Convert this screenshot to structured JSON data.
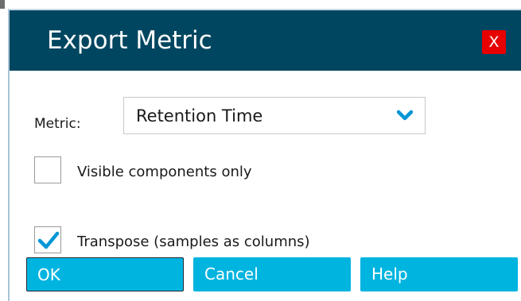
{
  "dialog": {
    "title": "Export Metric",
    "close_label": "X"
  },
  "metric": {
    "label": "Metric:",
    "selected": "Retention Time"
  },
  "options": {
    "visible_components_only": {
      "label": "Visible components only",
      "checked": false
    },
    "transpose": {
      "label": "Transpose (samples as columns)",
      "checked": true
    }
  },
  "buttons": {
    "ok": "OK",
    "cancel": "Cancel",
    "help": "Help"
  },
  "colors": {
    "titlebar": "#004660",
    "button": "#00b4e0",
    "close": "#e60000",
    "check": "#0096d6"
  },
  "icons": {
    "dropdown": "chevron-down-icon",
    "check": "checkmark-icon"
  }
}
